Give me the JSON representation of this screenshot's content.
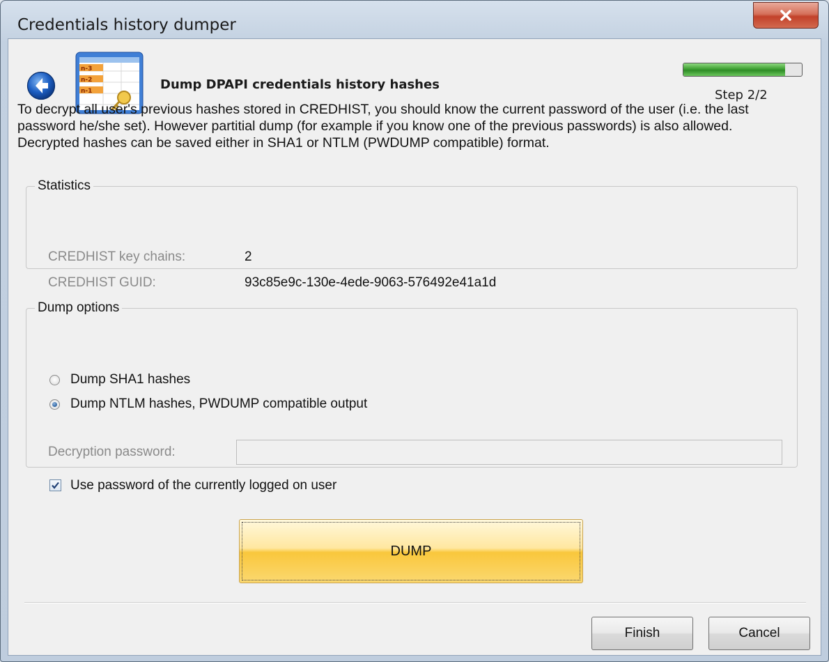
{
  "window": {
    "title": "Credentials history dumper",
    "close_label": "X"
  },
  "header": {
    "title": "Dump DPAPI credentials history hashes",
    "step_label": "Step 2/2",
    "progress_fraction": 0.86,
    "icon_labels": [
      "n-3",
      "n-2",
      "n-1"
    ]
  },
  "description": "To decrypt all user's previous hashes stored in CREDHIST, you should know the current password of the user (i.e. the last password he/she set). However partitial dump (for example if you know one of the previous passwords) is also allowed. Decrypted hashes can be saved either in SHA1 or NTLM (PWDUMP compatible) format.",
  "statistics": {
    "legend": "Statistics",
    "rows": [
      {
        "label": "CREDHIST key chains:",
        "value": "2"
      },
      {
        "label": "CREDHIST GUID:",
        "value": "93c85e9c-130e-4ede-9063-576492e41a1d"
      }
    ]
  },
  "dump_options": {
    "legend": "Dump options",
    "radio_sha1": {
      "label": "Dump SHA1 hashes",
      "selected": false
    },
    "radio_ntlm": {
      "label": "Dump NTLM hashes, PWDUMP compatible output",
      "selected": true
    },
    "password_label": "Decryption password:",
    "password_value": "",
    "use_current_user": {
      "label": "Use password of the currently logged on user",
      "checked": true
    }
  },
  "dump_button": "DUMP",
  "footer": {
    "finish": "Finish",
    "cancel": "Cancel"
  }
}
